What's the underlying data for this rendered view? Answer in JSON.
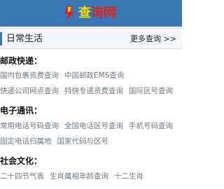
{
  "header": {
    "logo_icon": "lightning-bolt-logo",
    "logo_char1": "查",
    "logo_char2": "询",
    "logo_char3": "网",
    "colors": {
      "background": "#3a77b4",
      "logo_yellow": "#f5d800",
      "logo_red": "#e2231a"
    }
  },
  "section": {
    "title": "日常生活",
    "more": "更多查询 >>"
  },
  "categories": [
    {
      "title": "邮政快递：",
      "rows": [
        [
          "国内包裹资费查询",
          "中国邮政EMS查询"
        ],
        [
          "快递公司网点查询",
          "特快专递资费查询",
          "国际区号查询"
        ]
      ]
    },
    {
      "title": "电子通讯：",
      "rows": [
        [
          "常用电话号码查询",
          "全国电话区号查询",
          "手机号码查询"
        ],
        [
          "固定电话归属地",
          "国家代码与区号"
        ]
      ]
    },
    {
      "title": "社会文化：",
      "rows": [
        [
          "二十四节气表",
          "生肖属相年龄查询",
          "十二生肖"
        ]
      ]
    }
  ]
}
